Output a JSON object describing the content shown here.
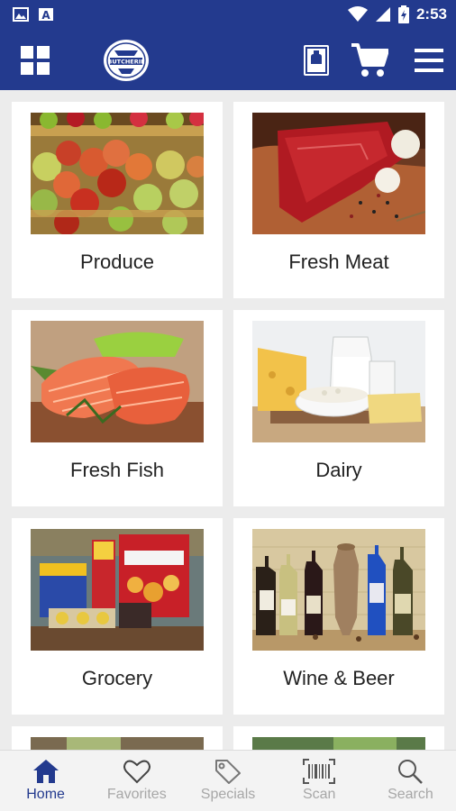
{
  "status_bar": {
    "time": "2:53"
  },
  "header": {
    "logo_text": "BUTCHERIE"
  },
  "categories": [
    {
      "label": "Produce"
    },
    {
      "label": "Fresh Meat"
    },
    {
      "label": "Fresh Fish"
    },
    {
      "label": "Dairy"
    },
    {
      "label": "Grocery"
    },
    {
      "label": "Wine & Beer"
    }
  ],
  "bottom_nav": [
    {
      "label": "Home",
      "icon": "home-icon",
      "active": true
    },
    {
      "label": "Favorites",
      "icon": "heart-icon",
      "active": false
    },
    {
      "label": "Specials",
      "icon": "tag-icon",
      "active": false
    },
    {
      "label": "Scan",
      "icon": "barcode-icon",
      "active": false
    },
    {
      "label": "Search",
      "icon": "search-icon",
      "active": false
    }
  ],
  "colors": {
    "primary": "#233a8e",
    "inactive": "#a7a7a7",
    "background": "#ececec"
  }
}
